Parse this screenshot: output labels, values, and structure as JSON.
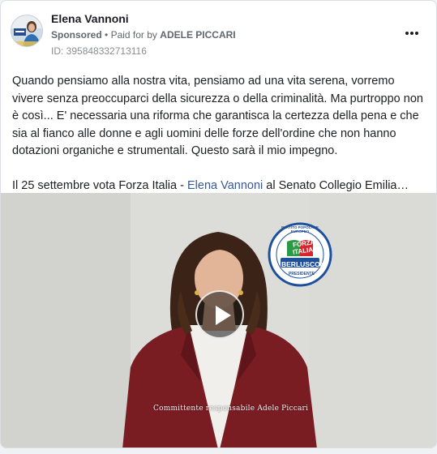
{
  "post": {
    "page_name": "Elena Vannoni",
    "sponsored_label": "Sponsored",
    "separator": "•",
    "paid_for_prefix": "Paid for by",
    "paid_for_name": "ADELE PICCARI",
    "ad_id": "ID: 395848332713116",
    "more_icon": "more-horizontal-icon"
  },
  "text": {
    "paragraph": "Quando pensiamo alla nostra vita, pensiamo ad una vita serena, vorremo vivere senza preoccuparci della sicurezza o della criminalità. Ma purtroppo non è così... E' necessaria una riforma che garantisca la certezza della pena e che sia al fianco alle donne e agli uomini delle forze dell'ordine che non hanno dotazioni organiche e strumentali. Questo sarà il mio impegno.",
    "cta_before": "Il 25 settembre vota Forza Italia - ",
    "cta_link": "Elena Vannoni",
    "cta_after": " al Senato Collegio Emilia…"
  },
  "video": {
    "play_icon": "play-icon",
    "caption": "Committente responsabile Adele Piccari",
    "logo": {
      "ring_text": "PARTITO POPOLARE EUROPEO",
      "forza": "FORZA",
      "italia": "ITALIA",
      "berlusconi": "BERLUSCONI",
      "presidente": "PRESIDENTE"
    }
  },
  "colors": {
    "link": "#385898",
    "logo_blue": "#1e4f9c",
    "flag_green": "#2b9a44",
    "flag_red": "#d5252e"
  }
}
